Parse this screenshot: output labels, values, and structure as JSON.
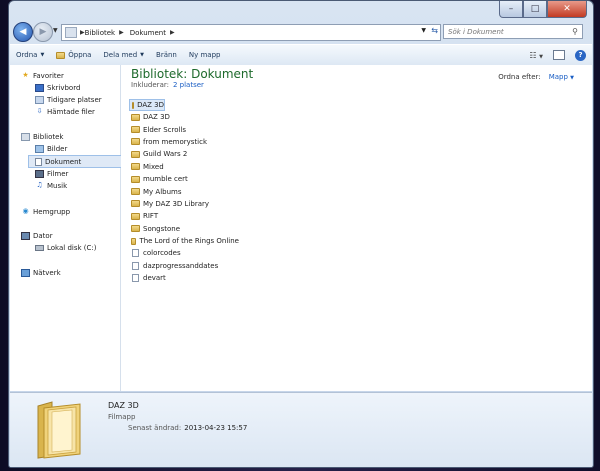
{
  "window": {
    "min": "–",
    "max": "□",
    "close": "✕"
  },
  "address": {
    "crumbs": [
      "Bibliotek",
      "Dokument"
    ],
    "search_placeholder": "Sök i Dokument"
  },
  "toolbar": {
    "organize": "Ordna",
    "open": "Öppna",
    "share": "Dela med",
    "burn": "Bränn",
    "new_folder": "Ny mapp",
    "help": "?"
  },
  "nav": {
    "favorites": "Favoriter",
    "desktop": "Skrivbord",
    "recent": "Tidigare platser",
    "downloads": "Hämtade filer",
    "libraries": "Bibliotek",
    "pictures": "Bilder",
    "documents": "Dokument",
    "videos": "Filmer",
    "music": "Musik",
    "homegroup": "Hemgrupp",
    "computer": "Dator",
    "local_disk": "Lokal disk (C:)",
    "network": "Nätverk"
  },
  "library": {
    "title": "Bibliotek: Dokument",
    "includes_label": "Inkluderar:",
    "includes_link": "2 platser",
    "sort_label": "Ordna efter:",
    "sort_value": "Mapp"
  },
  "files": [
    {
      "name": "DAZ 3D",
      "type": "folder"
    },
    {
      "name": "DAZ 3D",
      "type": "folder"
    },
    {
      "name": "Elder Scrolls",
      "type": "folder"
    },
    {
      "name": "from memorystick",
      "type": "folder"
    },
    {
      "name": "Guild Wars 2",
      "type": "folder"
    },
    {
      "name": "Mixed",
      "type": "folder"
    },
    {
      "name": "mumble cert",
      "type": "folder"
    },
    {
      "name": "My Albums",
      "type": "folder"
    },
    {
      "name": "My DAZ 3D Library",
      "type": "folder"
    },
    {
      "name": "RIFT",
      "type": "folder"
    },
    {
      "name": "Songstone",
      "type": "folder"
    },
    {
      "name": "The Lord of the Rings Online",
      "type": "folder"
    },
    {
      "name": "colorcodes",
      "type": "file"
    },
    {
      "name": "dazprogressanddates",
      "type": "file"
    },
    {
      "name": "devart",
      "type": "file"
    }
  ],
  "details": {
    "name": "DAZ 3D",
    "type": "Filmapp",
    "modified_label": "Senast ändrad:",
    "modified_value": "2013-04-23 15:57"
  }
}
